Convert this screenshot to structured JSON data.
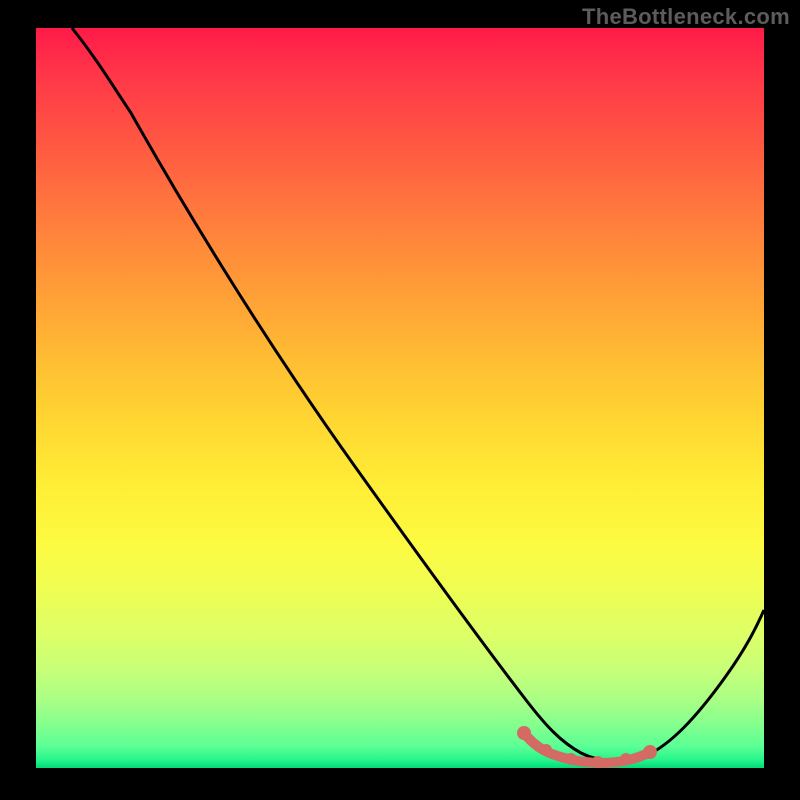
{
  "watermark": {
    "text": "TheBottleneck.com"
  },
  "chart_data": {
    "type": "line",
    "title": "",
    "xlabel": "",
    "ylabel": "",
    "xlim": [
      0,
      100
    ],
    "ylim": [
      0,
      100
    ],
    "grid": false,
    "series": [
      {
        "name": "bottleneck-curve",
        "x": [
          0,
          3,
          8,
          14,
          20,
          28,
          36,
          44,
          52,
          58,
          63,
          66,
          70,
          74,
          78,
          82,
          86,
          90,
          94,
          98,
          100
        ],
        "values": [
          100,
          98,
          95,
          91,
          85,
          77,
          68,
          58,
          47,
          38,
          30,
          24,
          16,
          8,
          3,
          1,
          1,
          3,
          10,
          20,
          26
        ]
      }
    ],
    "accent_region": {
      "name": "optimal-range",
      "x": [
        66,
        70,
        74,
        78,
        82,
        86
      ],
      "values": [
        4.2,
        3.2,
        2.2,
        1.6,
        1.6,
        2.4
      ]
    },
    "background_gradient": {
      "stops": [
        {
          "offset": 0,
          "color": "#ff1a49"
        },
        {
          "offset": 50,
          "color": "#ffd932"
        },
        {
          "offset": 80,
          "color": "#ddff67"
        },
        {
          "offset": 100,
          "color": "#04d977"
        }
      ]
    }
  }
}
